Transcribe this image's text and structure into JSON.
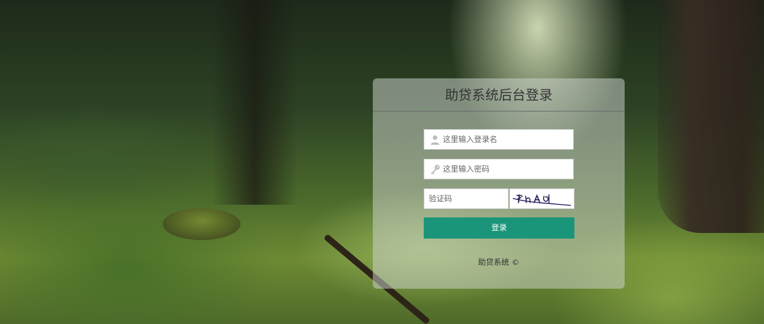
{
  "login": {
    "title": "助贷系统后台登录",
    "username_placeholder": "这里输入登录名",
    "password_placeholder": "这里输入密码",
    "captcha_placeholder": "验证码",
    "captcha_image_text": "7hAd",
    "login_button": "登录",
    "footer": "助贷系统 ©"
  },
  "colors": {
    "button_bg": "#1b9579",
    "panel_bg": "rgba(205,210,205,0.52)",
    "title_text": "#333333"
  },
  "icons": {
    "username": "user-icon",
    "password": "key-icon"
  }
}
